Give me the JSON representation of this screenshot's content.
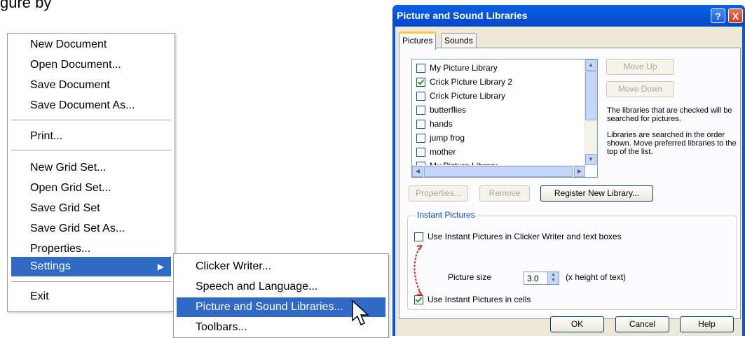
{
  "caption": "gure by",
  "menu": {
    "items": [
      {
        "label": "New Document"
      },
      {
        "label": "Open Document..."
      },
      {
        "label": "Save Document"
      },
      {
        "label": "Save Document As..."
      },
      {
        "label": "Print..."
      },
      {
        "label": "New Grid Set..."
      },
      {
        "label": "Open Grid Set..."
      },
      {
        "label": "Save Grid Set"
      },
      {
        "label": "Save Grid Set As..."
      },
      {
        "label": "Properties..."
      },
      {
        "label": "Settings"
      },
      {
        "label": "Exit"
      }
    ],
    "arrow_icon": "submenu-arrow-icon"
  },
  "submenu": {
    "items": [
      {
        "label": "Clicker Writer..."
      },
      {
        "label": "Speech and Language..."
      },
      {
        "label": "Picture and Sound Libraries..."
      },
      {
        "label": "Toolbars..."
      }
    ]
  },
  "dialog": {
    "title": "Picture and Sound Libraries",
    "help_glyph": "?",
    "close_glyph": "X",
    "tabs": [
      {
        "label": "Pictures"
      },
      {
        "label": "Sounds"
      }
    ],
    "libraries": [
      {
        "label": "My Picture Library",
        "checked": false
      },
      {
        "label": "Crick Picture Library 2",
        "checked": true
      },
      {
        "label": "Crick Picture Library",
        "checked": false
      },
      {
        "label": "butterflies",
        "checked": false
      },
      {
        "label": "hands",
        "checked": false
      },
      {
        "label": "jump frog",
        "checked": false
      },
      {
        "label": "mother",
        "checked": false
      },
      {
        "label": "My Picture Library",
        "checked": false
      }
    ],
    "move_up": "Move Up",
    "move_down": "Move Down",
    "info1": "The libraries that are checked will be searched for pictures.",
    "info2": "Libraries are searched in the order shown. Move preferred libraries to the top of the list.",
    "properties": "Properties...",
    "remove": "Remove",
    "register": "Register New Library...",
    "instant_group": "Instant Pictures",
    "opt_writer": "Use Instant Pictures in Clicker Writer and text boxes",
    "opt_writer_checked": false,
    "picture_size_label": "Picture size",
    "picture_size_value": "3.0",
    "picture_size_unit": "(x height of text)",
    "opt_cells": "Use Instant Pictures in cells",
    "opt_cells_checked": true,
    "ok": "OK",
    "cancel": "Cancel",
    "help": "Help"
  },
  "colors": {
    "highlight": "#316ac5",
    "titlebar": "#0855dd",
    "annotation": "#e02020"
  }
}
